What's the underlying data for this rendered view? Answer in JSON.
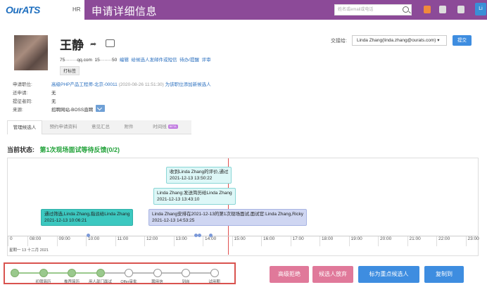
{
  "topbar": {
    "logo": "OurATS",
    "hr_label": "HR",
    "page_title": "申请详细信息",
    "search_placeholder": "姓名或email或电话",
    "avatar_initials": "Li"
  },
  "candidate": {
    "name": "王静",
    "email": "75········qq.com",
    "phone": "15········50",
    "actions": [
      "编辑",
      "给候选人发邮件或短信",
      "待办/提醒",
      "评审"
    ],
    "tag_label": "打标签"
  },
  "assign": {
    "label": "交接给:",
    "selected": "Linda Zhang(linda.zhang@ourats.com)",
    "submit_label": "提交"
  },
  "info": {
    "job_label": "申请职位:",
    "job_value": "高级PHP产品工程师-北京-00011",
    "job_date": "(2020-08-26 11:51:30)",
    "job_link": "为该职位添加新候选人",
    "other_label": "还申请:",
    "other_value": "无",
    "colleague_label": "提征者同:",
    "colleague_value": "无",
    "source_label": "来源:",
    "source_value": "招聘网站-BOSS直聘"
  },
  "tabs": [
    {
      "label": "管理候选人"
    },
    {
      "label": "预约申请资料"
    },
    {
      "label": "意见汇总"
    },
    {
      "label": "附件"
    },
    {
      "label": "时间线",
      "badge": "BETA"
    }
  ],
  "status": {
    "label": "当前状态:",
    "value": "第1次现场面试等待反馈(0/2)"
  },
  "timeline": {
    "ticks": [
      "0",
      "08:00",
      "09:00",
      "10:00",
      "11:00",
      "12:00",
      "13:00",
      "14:00",
      "15:00",
      "16:00",
      "17:00",
      "18:00",
      "19:00",
      "20:00",
      "21:00",
      "22:00",
      "23:00"
    ],
    "date_label": "星期一 13 十二月 2021",
    "events": [
      {
        "text": "收到Linda Zhang的评价,通过",
        "time": "2021-12-13 13:50:22"
      },
      {
        "text": "Linda Zhang:发送简历给Linda Zhang",
        "time": "2021-12-13 13:43:10"
      },
      {
        "text": "通过筛选,Linda Zhang,指派给Linda Zhang",
        "time": "2021-12-13 10:06:21"
      },
      {
        "text": "Linda Zhang安排在2021-12-13的第1次现场面试,面试官:Linda Zhang,Ricky",
        "time": "2021-12-13 14:53:25"
      }
    ]
  },
  "steps": [
    {
      "label": "",
      "done": true
    },
    {
      "label": "初筛简历",
      "done": true
    },
    {
      "label": "推荐简历",
      "done": true
    },
    {
      "label": "用人部门面试",
      "done": true
    },
    {
      "label": "Offer审批",
      "done": false
    },
    {
      "label": "聘用信",
      "done": false
    },
    {
      "label": "到岗",
      "done": false
    },
    {
      "label": "试用期",
      "done": false
    }
  ],
  "actions": {
    "reject": "高级拒绝",
    "withdraw": "候选人放弃",
    "key": "标为重点候选人",
    "copy": "复制到"
  },
  "colors": {
    "purple": "#8c4a98",
    "teal": "#3cc8c0",
    "lavender": "#cfd6f2",
    "pink": "#e0799a",
    "blue": "#3e8de0",
    "green": "#22a23a"
  }
}
